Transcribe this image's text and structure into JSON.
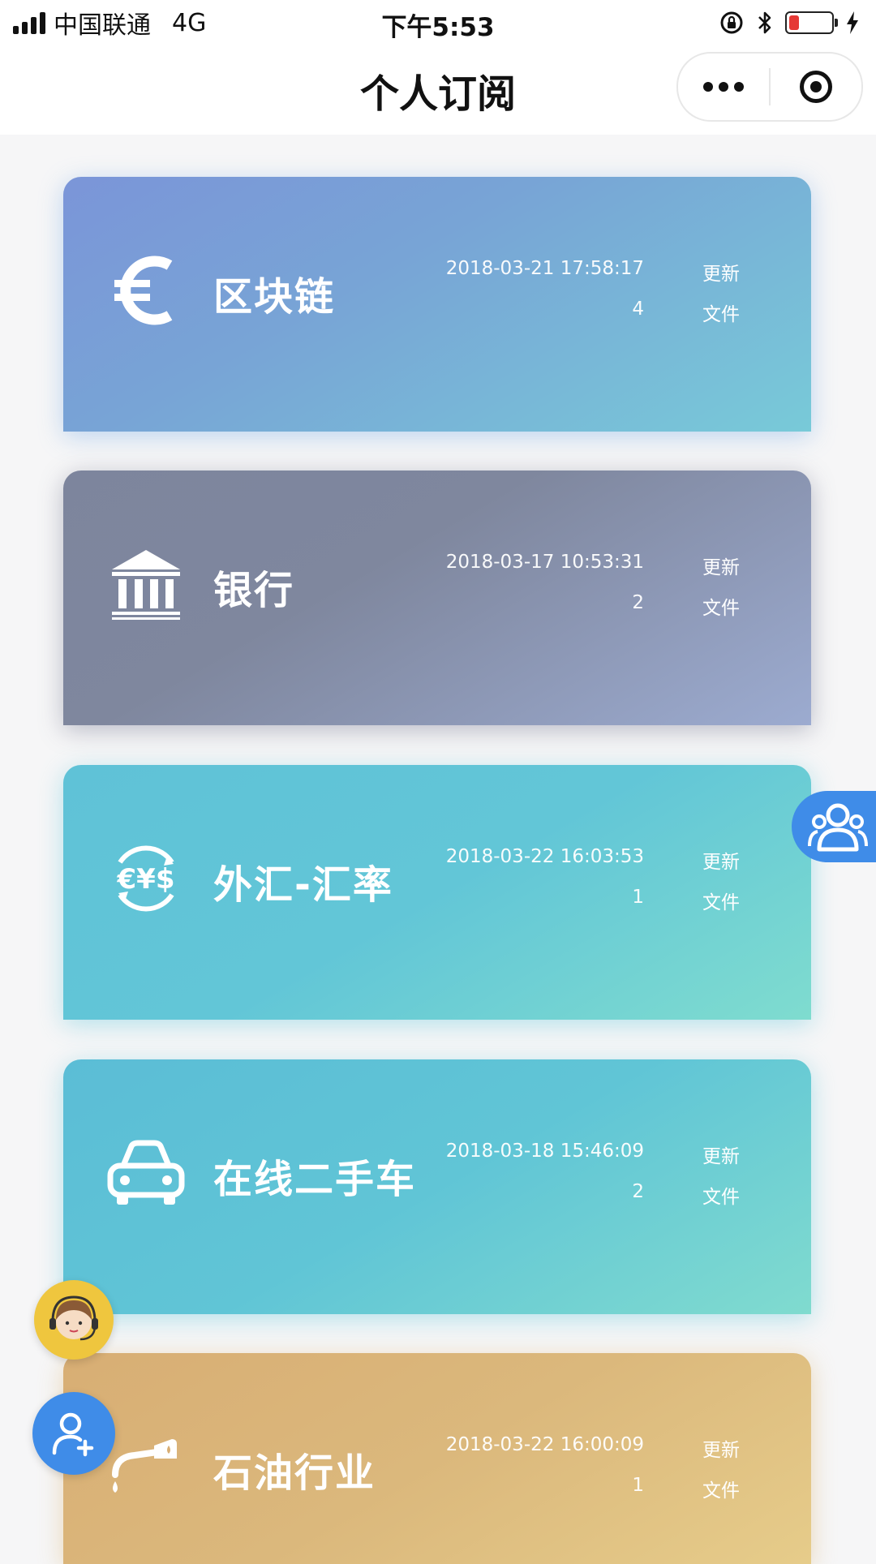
{
  "status_bar": {
    "carrier": "中国联通",
    "network": "4G",
    "time": "下午5:53",
    "battery_level": 0.25,
    "battery_color": "#e53935"
  },
  "header": {
    "title": "个人订阅"
  },
  "subscriptions": [
    {
      "name": "区块链",
      "icon": "euro-icon",
      "date": "2018-03-21 17:58:17",
      "count": "4",
      "update_label": "更新",
      "file_label": "文件"
    },
    {
      "name": "银行",
      "icon": "bank-icon",
      "date": "2018-03-17 10:53:31",
      "count": "2",
      "update_label": "更新",
      "file_label": "文件"
    },
    {
      "name": "外汇-汇率",
      "icon": "currency-exchange-icon",
      "date": "2018-03-22 16:03:53",
      "count": "1",
      "update_label": "更新",
      "file_label": "文件"
    },
    {
      "name": "在线二手车",
      "icon": "car-icon",
      "date": "2018-03-18 15:46:09",
      "count": "2",
      "update_label": "更新",
      "file_label": "文件"
    },
    {
      "name": "石油行业",
      "icon": "oil-nozzle-icon",
      "date": "2018-03-22 16:00:09",
      "count": "1",
      "update_label": "更新",
      "file_label": "文件"
    }
  ],
  "colors": {
    "accent": "#3f8ce8",
    "support_bg": "#efc63e"
  }
}
